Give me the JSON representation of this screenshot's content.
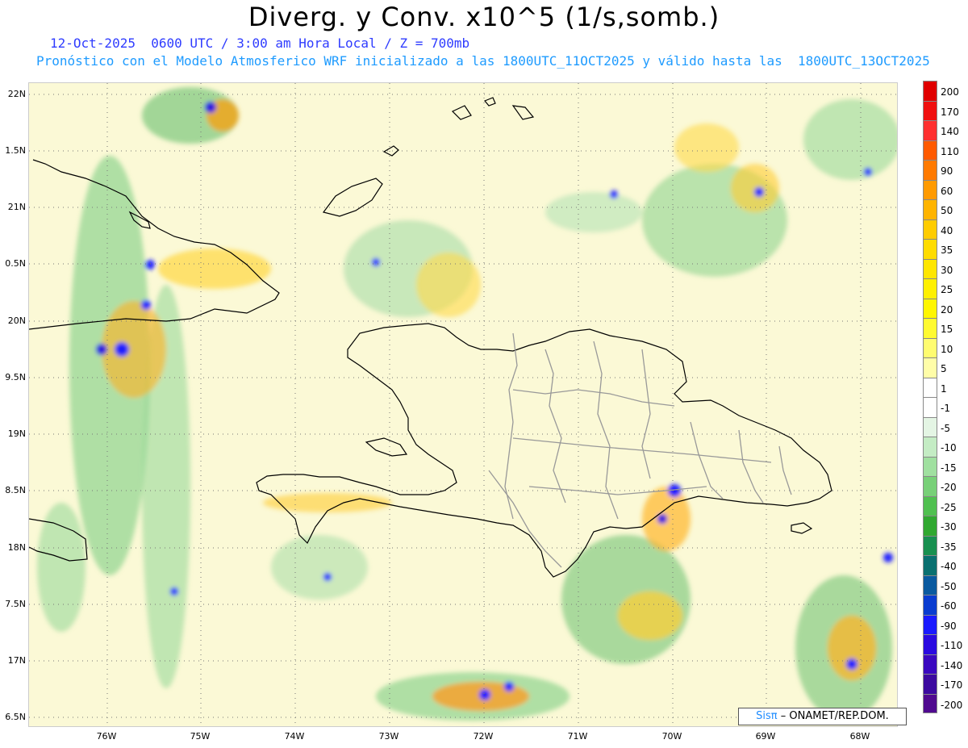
{
  "title": "Diverg. y Conv. x10^5 (1/s,somb.)",
  "subtitle1": "12-Oct-2025  0600 UTC / 3:00 am Hora Local / Z = 700mb",
  "subtitle2": "Pronóstico con el Modelo Atmosferico WRF inicializado a las 1800UTC_11OCT2025 y válido hasta las  1800UTC_13OCT2025",
  "y_ticks": [
    "22N",
    "1.5N",
    "21N",
    "0.5N",
    "20N",
    "9.5N",
    "19N",
    "8.5N",
    "18N",
    "7.5N",
    "17N",
    "6.5N"
  ],
  "x_ticks": [
    "76W",
    "75W",
    "74W",
    "73W",
    "72W",
    "71W",
    "70W",
    "69W",
    "68W"
  ],
  "colorbar": {
    "labels": [
      "200",
      "170",
      "140",
      "110",
      "90",
      "60",
      "50",
      "40",
      "35",
      "30",
      "25",
      "20",
      "15",
      "10",
      "5",
      "1",
      "-1",
      "-5",
      "-10",
      "-15",
      "-20",
      "-25",
      "-30",
      "-35",
      "-40",
      "-50",
      "-60",
      "-90",
      "-110",
      "-140",
      "-170",
      "-200"
    ],
    "colors": [
      "#e00000",
      "#f01010",
      "#ff3030",
      "#ff5a00",
      "#ff7a00",
      "#ff9a00",
      "#ffb400",
      "#ffcc00",
      "#ffdc00",
      "#ffe600",
      "#fff000",
      "#fff600",
      "#fffa30",
      "#fffc70",
      "#fffda8",
      "#ffffff",
      "#ffffff",
      "#e4f5e4",
      "#c4ecc4",
      "#a0e0a0",
      "#78d078",
      "#50c050",
      "#30a830",
      "#189050",
      "#0a7070",
      "#0a5aa0",
      "#0a3cd0",
      "#1a1aff",
      "#2a0ae0",
      "#3a08c0",
      "#3c0aa0",
      "#500a90"
    ]
  },
  "credit": {
    "sis": "Sisπ",
    "org": "– ONAMET/REP.DOM."
  },
  "colors": {
    "coast": "#000000",
    "provinces": "#999999",
    "grid": "#777777"
  }
}
